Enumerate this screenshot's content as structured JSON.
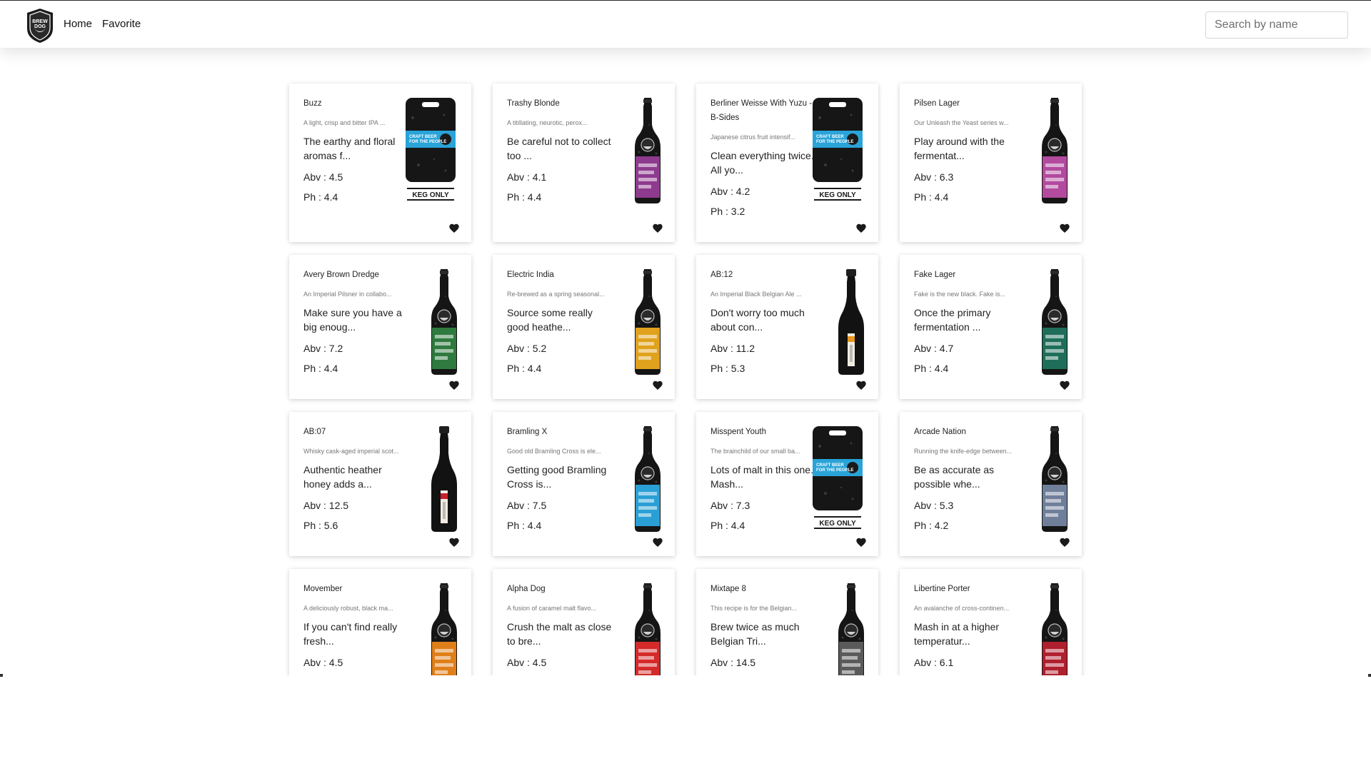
{
  "nav": {
    "home_label": "Home",
    "favorite_label": "Favorite",
    "search_placeholder": "Search by name",
    "search_value": "",
    "logo_text": "BREW DOG"
  },
  "colors": {
    "card_bg": "#ffffff",
    "text": "#212121",
    "muted": "#777777"
  },
  "beers": [
    {
      "name": "Buzz",
      "tagline": "A light, crisp and bitter IPA ...",
      "description": "The earthy and floral aromas f...",
      "abv": "Abv : 4.5",
      "ph": "Ph : 4.4",
      "image": "keg",
      "label_color": "#29a3d8",
      "keg_text": "KEG ONLY",
      "favorite_icon": "heart-icon"
    },
    {
      "name": "Trashy Blonde",
      "tagline": "A titillating, neurotic, perox...",
      "description": "Be careful not to collect too ...",
      "abv": "Abv : 4.1",
      "ph": "Ph : 4.4",
      "image": "bottle",
      "label_color": "#8e3a8e",
      "favorite_icon": "heart-icon"
    },
    {
      "name": "Berliner Weisse With Yuzu - B-Sides",
      "tagline": "Japanese citrus fruit intensif...",
      "description": "Clean everything twice. All yo...",
      "abv": "Abv : 4.2",
      "ph": "Ph : 3.2",
      "image": "keg",
      "label_color": "#29a3d8",
      "keg_text": "KEG ONLY",
      "favorite_icon": "heart-icon"
    },
    {
      "name": "Pilsen Lager",
      "tagline": "Our Unleash the Yeast series w...",
      "description": "Play around with the fermentat...",
      "abv": "Abv : 6.3",
      "ph": "Ph : 4.4",
      "image": "bottle",
      "label_color": "#b24a9e",
      "favorite_icon": "heart-icon"
    },
    {
      "name": "Avery Brown Dredge",
      "tagline": "An Imperial Pilsner in collabo...",
      "description": "Make sure you have a big enoug...",
      "abv": "Abv : 7.2",
      "ph": "Ph : 4.4",
      "image": "bottle",
      "label_color": "#2f7a3e",
      "favorite_icon": "heart-icon"
    },
    {
      "name": "Electric India",
      "tagline": "Re-brewed as a spring seasonal...",
      "description": "Source some really good heathe...",
      "abv": "Abv : 5.2",
      "ph": "Ph : 4.4",
      "image": "bottle",
      "label_color": "#e0a11c",
      "favorite_icon": "heart-icon"
    },
    {
      "name": "AB:12",
      "tagline": "An Imperial Black Belgian Ale ...",
      "description": "Don't worry too much about con...",
      "abv": "Abv : 11.2",
      "ph": "Ph : 5.3",
      "image": "champagne",
      "label_color": "#e8961e",
      "favorite_icon": "heart-icon"
    },
    {
      "name": "Fake Lager",
      "tagline": "Fake is the new black. Fake is...",
      "description": "Once the primary fermentation ...",
      "abv": "Abv : 4.7",
      "ph": "Ph : 4.4",
      "image": "bottle",
      "label_color": "#1f6e5a",
      "favorite_icon": "heart-icon"
    },
    {
      "name": "AB:07",
      "tagline": "Whisky cask-aged imperial scot...",
      "description": "Authentic heather honey adds a...",
      "abv": "Abv : 12.5",
      "ph": "Ph : 5.6",
      "image": "champagne",
      "label_color": "#c8202c",
      "favorite_icon": "heart-icon"
    },
    {
      "name": "Bramling X",
      "tagline": "Good old Bramling Cross is ele...",
      "description": "Getting good Bramling Cross is...",
      "abv": "Abv : 7.5",
      "ph": "Ph : 4.4",
      "image": "bottle",
      "label_color": "#2a9fd6",
      "favorite_icon": "heart-icon"
    },
    {
      "name": "Misspent Youth",
      "tagline": "The brainchild of our small ba...",
      "description": "Lots of malt in this one. Mash...",
      "abv": "Abv : 7.3",
      "ph": "Ph : 4.4",
      "image": "keg",
      "label_color": "#29a3d8",
      "keg_text": "KEG ONLY",
      "favorite_icon": "heart-icon"
    },
    {
      "name": "Arcade Nation",
      "tagline": "Running the knife-edge between...",
      "description": "Be as accurate as possible whe...",
      "abv": "Abv : 5.3",
      "ph": "Ph : 4.2",
      "image": "bottle",
      "label_color": "#6f7f9a",
      "favorite_icon": "heart-icon"
    },
    {
      "name": "Movember",
      "tagline": "A deliciously robust, black ma...",
      "description": "If you can't find really fresh...",
      "abv": "Abv : 4.5",
      "ph": "",
      "image": "bottle",
      "label_color": "#e07f1a",
      "favorite_icon": "heart-icon"
    },
    {
      "name": "Alpha Dog",
      "tagline": "A fusion of caramel malt flavo...",
      "description": "Crush the malt as close to bre...",
      "abv": "Abv : 4.5",
      "ph": "",
      "image": "bottle",
      "label_color": "#d42a2a",
      "favorite_icon": "heart-icon"
    },
    {
      "name": "Mixtape 8",
      "tagline": "This recipe is for the Belgian...",
      "description": "Brew twice as much Belgian Tri...",
      "abv": "Abv : 14.5",
      "ph": "",
      "image": "bottle",
      "label_color": "#5a5a5a",
      "favorite_icon": "heart-icon"
    },
    {
      "name": "Libertine Porter",
      "tagline": "An avalanche of cross-continen...",
      "description": "Mash in at a higher temperatur...",
      "abv": "Abv : 6.1",
      "ph": "",
      "image": "bottle",
      "label_color": "#b01f2e",
      "favorite_icon": "heart-icon"
    }
  ]
}
